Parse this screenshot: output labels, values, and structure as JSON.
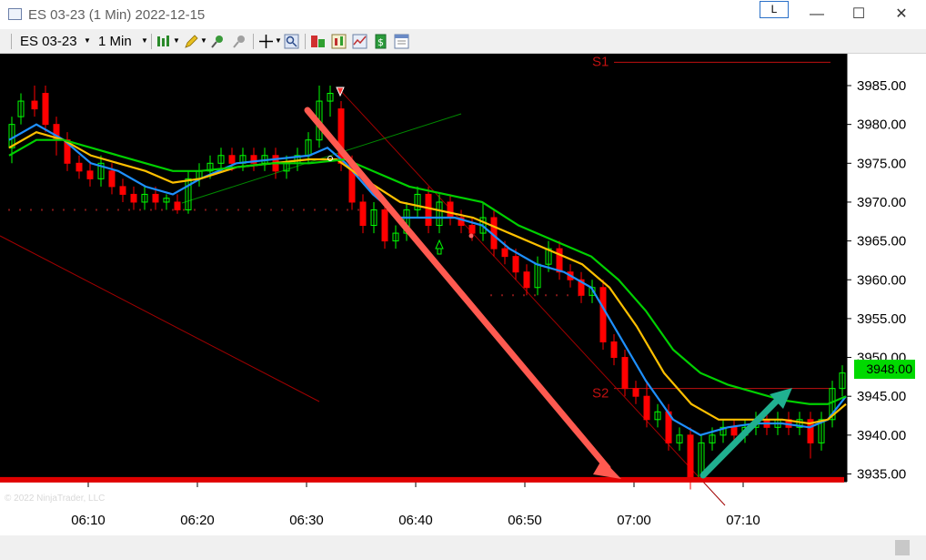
{
  "window": {
    "title": "ES 03-23 (1 Min)  2022-12-15",
    "link_label": "L",
    "minimize": "—",
    "maximize": "☐",
    "close": "✕"
  },
  "toolbar": {
    "instrument": "ES 03-23",
    "interval": "1 Min",
    "icons": [
      "bars-icon",
      "pencil-draw-icon",
      "zoom-in-icon",
      "zoom-out-icon",
      "crosshair-icon",
      "magnify-icon",
      "indicators-icon",
      "strategies-icon",
      "chart-style-icon",
      "properties-icon",
      "data-box-icon"
    ]
  },
  "chart": {
    "copyright": "© 2022 NinjaTrader, LLC",
    "last_price": "3948.00",
    "level_labels": [
      "S1",
      "S2"
    ],
    "colors": {
      "background": "#000000",
      "up_candle": "#00ff00",
      "down_candle": "#ff0000",
      "ema_fast": "#1e90ff",
      "ema_mid": "#ffc000",
      "ema_slow": "#00d000",
      "arrow_down": "#ff5a50",
      "arrow_up": "#20b090",
      "support_line": "#e00000"
    }
  },
  "chart_data": {
    "type": "candlestick",
    "ylim": [
      3932.5,
      3988
    ],
    "y_ticks": [
      "3985.00",
      "3980.00",
      "3975.00",
      "3970.00",
      "3965.00",
      "3960.00",
      "3955.00",
      "3950.00",
      "3945.00",
      "3940.00",
      "3935.00"
    ],
    "x_ticks": [
      "06:10",
      "06:20",
      "06:30",
      "06:40",
      "06:50",
      "07:00",
      "07:10"
    ],
    "last_price": 3948.0,
    "support_level": 3934.25,
    "s1_level": 3988,
    "s2_level": 3946
  }
}
